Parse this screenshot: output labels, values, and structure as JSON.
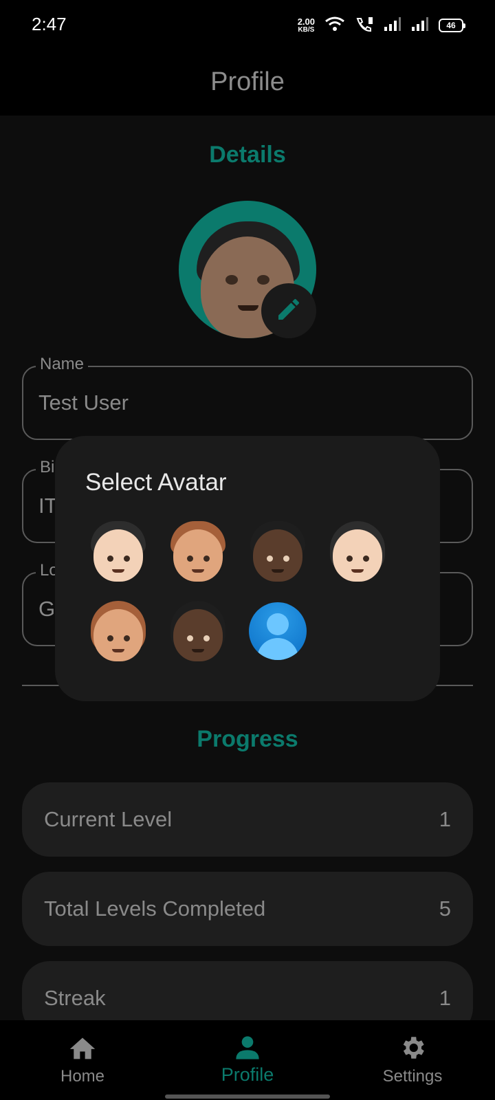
{
  "status_bar": {
    "time": "2:47",
    "net_speed_value": "2.00",
    "net_speed_unit": "KB/S",
    "battery": "46"
  },
  "app_bar": {
    "title": "Profile"
  },
  "details": {
    "title": "Details",
    "fields": [
      {
        "label": "Name",
        "value": "Test User"
      },
      {
        "label": "Bi",
        "value": "IT"
      },
      {
        "label": "Lo",
        "value": "G"
      }
    ]
  },
  "avatar_dialog": {
    "title": "Select Avatar",
    "options": [
      "man-light-skin",
      "man-medium-light-skin",
      "man-dark-skin",
      "woman-light-skin",
      "woman-medium-light-skin",
      "woman-dark-skin",
      "generic-person-icon"
    ]
  },
  "progress": {
    "title": "Progress",
    "stats": [
      {
        "label": "Current Level",
        "value": "1"
      },
      {
        "label": "Total Levels Completed",
        "value": "5"
      },
      {
        "label": "Streak",
        "value": "1"
      }
    ]
  },
  "bottom_nav": {
    "items": [
      {
        "label": "Home",
        "icon": "home-icon"
      },
      {
        "label": "Profile",
        "icon": "person-icon",
        "active": true
      },
      {
        "label": "Settings",
        "icon": "gear-icon"
      }
    ]
  },
  "colors": {
    "accent": "#0b7a6c",
    "background": "#0d0d0d",
    "card": "#1e1e1e",
    "dialog": "#1b1b1b"
  }
}
